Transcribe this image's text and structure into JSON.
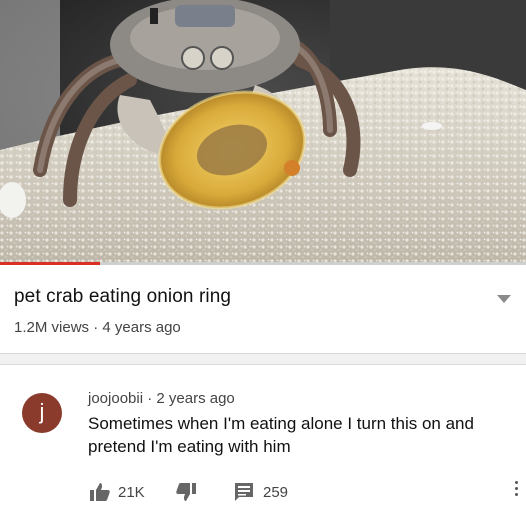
{
  "video": {
    "title": "pet crab eating onion ring",
    "views": "1.2M views",
    "separator": "·",
    "age": "4 years ago",
    "progress": 0.19,
    "accent": "#d93025"
  },
  "comment": {
    "avatar_letter": "j",
    "avatar_color": "#8a3b2c",
    "author": "joojoobii",
    "separator": "·",
    "age": "2 years ago",
    "text": "Sometimes when I'm eating alone I turn this on and pretend I'm eating with him",
    "likes": "21K",
    "replies": "259",
    "icons": [
      "thumbs-up-icon",
      "thumbs-down-icon",
      "reply-icon",
      "more-vert-icon"
    ]
  }
}
